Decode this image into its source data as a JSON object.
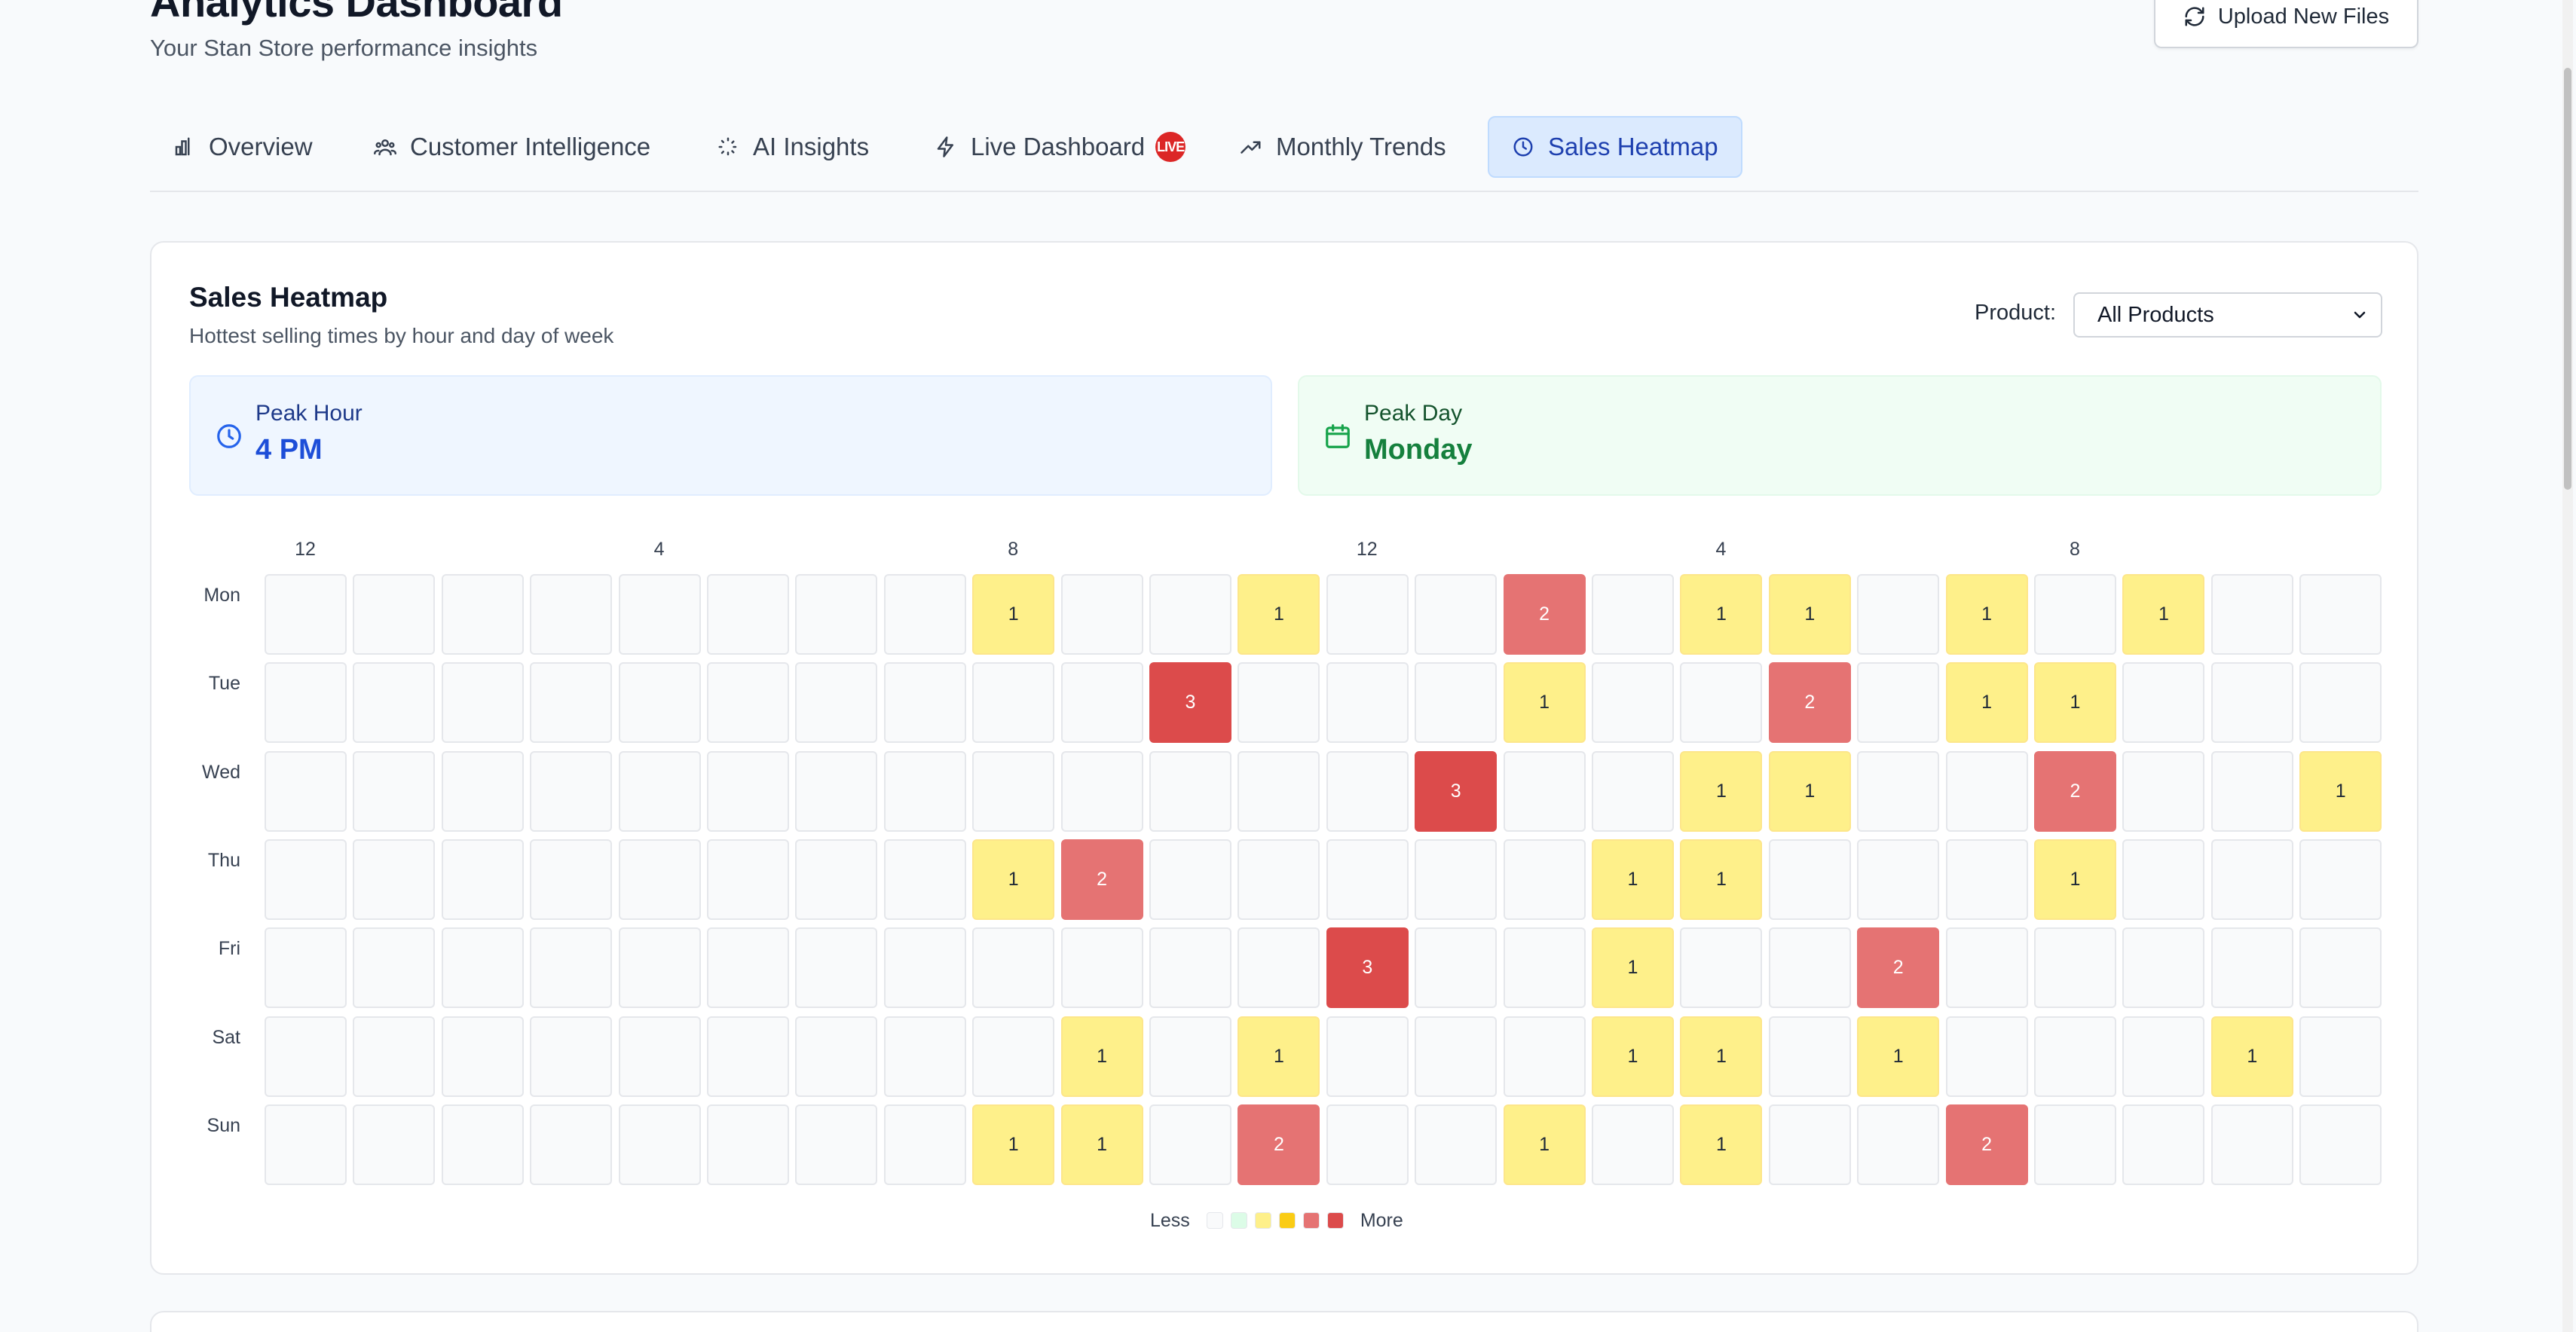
{
  "header": {
    "title": "Analytics Dashboard",
    "subtitle": "Your Stan Store performance insights",
    "upload_label": "Upload New Files"
  },
  "tabs": [
    {
      "label": "Overview",
      "icon": "bar-chart-icon"
    },
    {
      "label": "Customer Intelligence",
      "icon": "users-icon"
    },
    {
      "label": "AI Insights",
      "icon": "sparkle-icon"
    },
    {
      "label": "Live Dashboard",
      "icon": "lightning-icon",
      "badge": "LIVE"
    },
    {
      "label": "Monthly Trends",
      "icon": "trending-up-icon"
    },
    {
      "label": "Sales Heatmap",
      "icon": "clock-icon",
      "active": true
    }
  ],
  "heatmap_card": {
    "title": "Sales Heatmap",
    "subtitle": "Hottest selling times by hour and day of week",
    "product_label": "Product:",
    "product_selected": "All Products",
    "peak_hour_label": "Peak Hour",
    "peak_hour_value": "4 PM",
    "peak_day_label": "Peak Day",
    "peak_day_value": "Monday",
    "legend_less": "Less",
    "legend_more": "More"
  },
  "colors": {
    "accent": "#1d4ed8",
    "level_0": "#f9fafb",
    "level_1": "#fef08a",
    "level_2": "#e57373",
    "level_3": "#dc4b4b",
    "legend_swatches": [
      "#f9fafb",
      "#dcfce7",
      "#fef08a",
      "#facc15",
      "#e57373",
      "#dc4b4b"
    ]
  },
  "chart_data": {
    "type": "heatmap",
    "hour_tick_labels": [
      "12",
      "4",
      "8",
      "12",
      "4",
      "8"
    ],
    "hour_tick_positions": [
      0,
      4,
      8,
      12,
      16,
      20
    ],
    "hours": [
      0,
      1,
      2,
      3,
      4,
      5,
      6,
      7,
      8,
      9,
      10,
      11,
      12,
      13,
      14,
      15,
      16,
      17,
      18,
      19,
      20,
      21,
      22,
      23
    ],
    "days": [
      "Mon",
      "Tue",
      "Wed",
      "Thu",
      "Fri",
      "Sat",
      "Sun"
    ],
    "values": [
      [
        0,
        0,
        0,
        0,
        0,
        0,
        0,
        0,
        1,
        0,
        0,
        1,
        0,
        0,
        2,
        0,
        1,
        1,
        0,
        1,
        0,
        1,
        0,
        0
      ],
      [
        0,
        0,
        0,
        0,
        0,
        0,
        0,
        0,
        0,
        0,
        3,
        0,
        0,
        0,
        1,
        0,
        0,
        2,
        0,
        1,
        1,
        0,
        0,
        0
      ],
      [
        0,
        0,
        0,
        0,
        0,
        0,
        0,
        0,
        0,
        0,
        0,
        0,
        0,
        3,
        0,
        0,
        1,
        1,
        0,
        0,
        2,
        0,
        0,
        1
      ],
      [
        0,
        0,
        0,
        0,
        0,
        0,
        0,
        0,
        1,
        2,
        0,
        0,
        0,
        0,
        0,
        1,
        1,
        0,
        0,
        0,
        1,
        0,
        0,
        0
      ],
      [
        0,
        0,
        0,
        0,
        0,
        0,
        0,
        0,
        0,
        0,
        0,
        0,
        3,
        0,
        0,
        1,
        0,
        0,
        2,
        0,
        0,
        0,
        0,
        0
      ],
      [
        0,
        0,
        0,
        0,
        0,
        0,
        0,
        0,
        0,
        1,
        0,
        1,
        0,
        0,
        0,
        1,
        1,
        0,
        1,
        0,
        0,
        0,
        1,
        0
      ],
      [
        0,
        0,
        0,
        0,
        0,
        0,
        0,
        0,
        1,
        1,
        0,
        2,
        0,
        0,
        1,
        0,
        1,
        0,
        0,
        2,
        0,
        0,
        0,
        0
      ]
    ]
  }
}
